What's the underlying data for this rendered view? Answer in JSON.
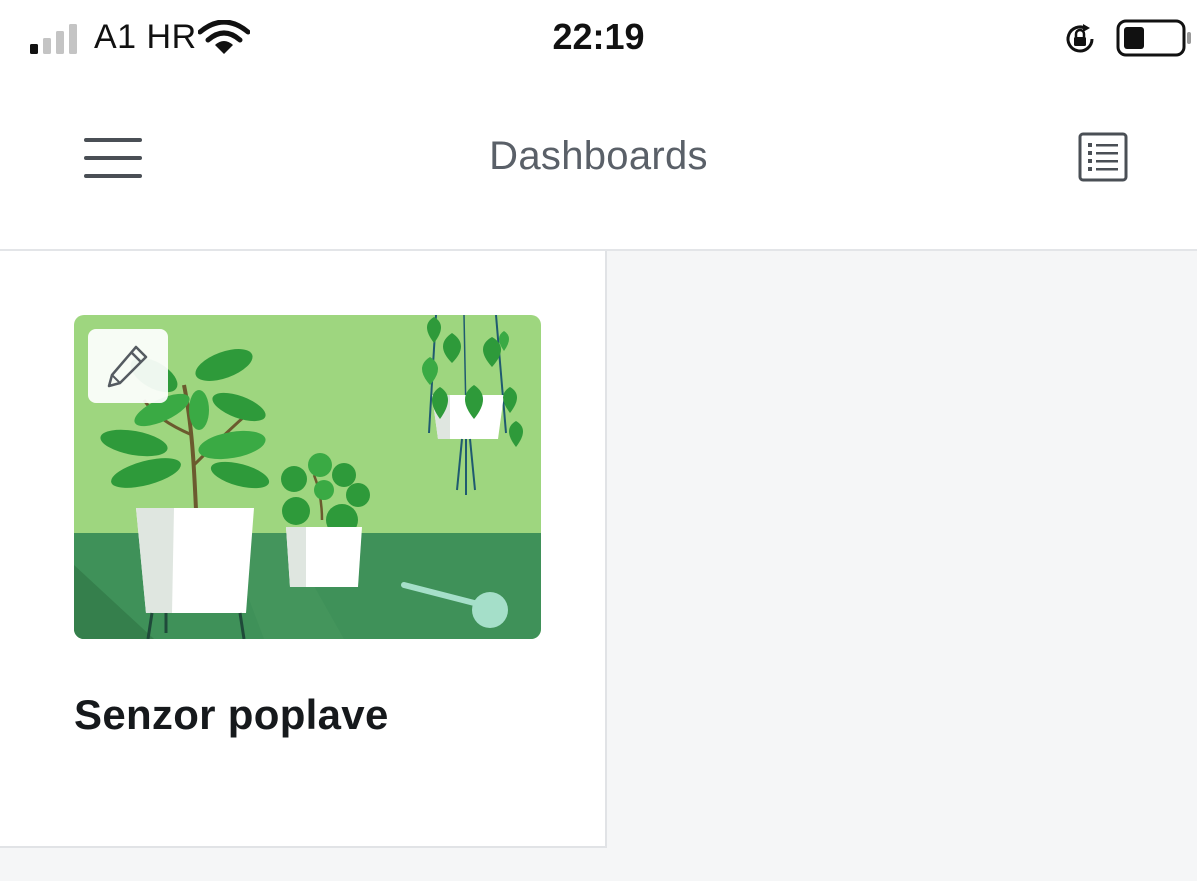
{
  "status_bar": {
    "carrier": "A1 HR",
    "time": "22:19",
    "icons": [
      "signal-icon",
      "wifi-icon",
      "rotation-lock-icon",
      "battery-icon"
    ]
  },
  "header": {
    "title": "Dashboards",
    "menu_icon": "hamburger-menu-icon",
    "view_icon": "list-view-icon"
  },
  "dashboards": [
    {
      "title": "Senzor poplave",
      "image": "plants-illustration",
      "edit_icon": "pencil-icon"
    }
  ],
  "colors": {
    "header_title": "#5a6068",
    "card_title": "#16191c",
    "image_wall": "#9ed67f",
    "image_table": "#3f9159",
    "leaf": "#2e9a3a",
    "background": "#f5f6f7"
  }
}
